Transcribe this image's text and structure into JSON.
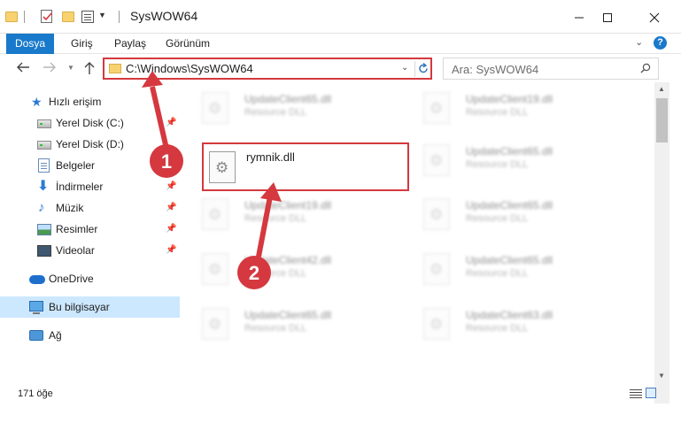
{
  "window": {
    "title": "SysWOW64"
  },
  "ribbon": {
    "tabs": [
      {
        "label": "Dosya"
      },
      {
        "label": "Giriş"
      },
      {
        "label": "Paylaş"
      },
      {
        "label": "Görünüm"
      }
    ],
    "help": "?"
  },
  "nav": {
    "address": "C:\\Windows\\SysWOW64",
    "search_placeholder": "Ara: SysWOW64"
  },
  "sidebar": {
    "items": [
      {
        "label": "Hızlı erişim",
        "icon": "star-icon"
      },
      {
        "label": "Yerel Disk (C:)",
        "icon": "drive-icon",
        "pinned": true
      },
      {
        "label": "Yerel Disk (D:)",
        "icon": "drive-icon"
      },
      {
        "label": "Belgeler",
        "icon": "documents-icon",
        "pinned": true
      },
      {
        "label": "İndirmeler",
        "icon": "download-icon",
        "pinned": true
      },
      {
        "label": "Müzik",
        "icon": "music-icon",
        "pinned": true
      },
      {
        "label": "Resimler",
        "icon": "pictures-icon",
        "pinned": true
      },
      {
        "label": "Videolar",
        "icon": "videos-icon",
        "pinned": true
      },
      {
        "label": "OneDrive",
        "icon": "onedrive-cloud-icon"
      },
      {
        "label": "Bu bilgisayar",
        "icon": "computer-icon",
        "selected": true
      },
      {
        "label": "Ağ",
        "icon": "network-icon"
      }
    ]
  },
  "files": {
    "type_label": "Resource DLL",
    "highlighted": "rymnik.dll",
    "left_column": [
      "UpdateClient65.dll",
      "UpdateClient19.dll",
      "UpdateClient42.dll",
      "UpdateClient65.dll"
    ],
    "right_column": [
      "UpdateClient19.dll",
      "UpdateClient65.dll",
      "UpdateClient65.dll",
      "UpdateClient65.dll",
      "UpdateClient63.dll"
    ]
  },
  "status": {
    "count": "171 öğe"
  },
  "annotations": {
    "step1": "1",
    "step2": "2",
    "color": "#d5383f"
  },
  "colors": {
    "accent": "#1979ca",
    "selection": "#cce8ff",
    "highlight_border": "#d5383f"
  }
}
